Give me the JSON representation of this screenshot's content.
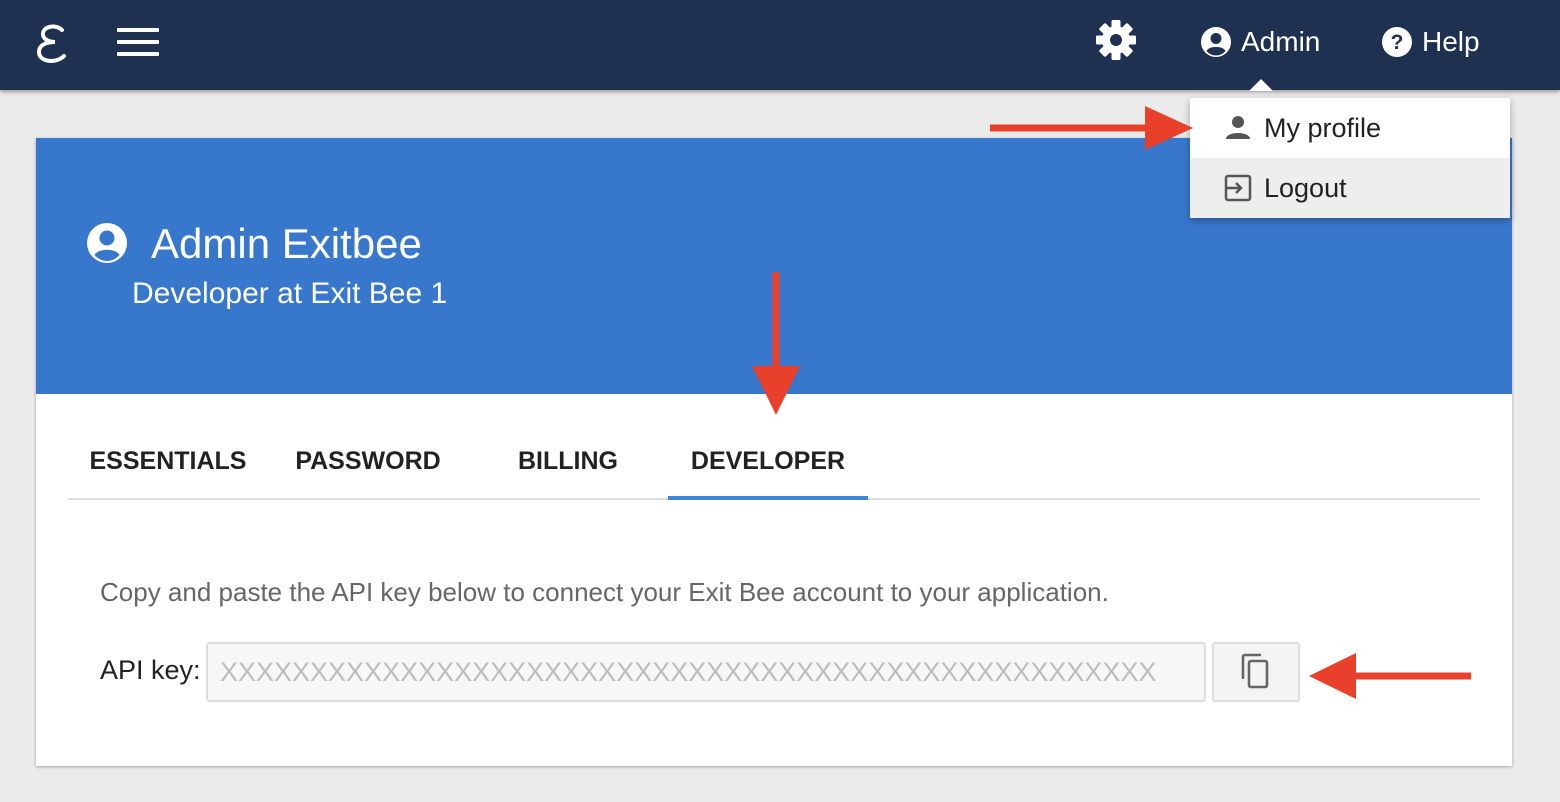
{
  "header": {
    "logo_icon": "exitbee-e-logo",
    "menu_icon": "hamburger-menu-icon",
    "settings_icon": "gear-icon",
    "admin_label": "Admin",
    "help_label": "Help",
    "background_color": "#1e3151"
  },
  "dropdown": {
    "items": [
      {
        "icon": "person-icon",
        "label": "My profile"
      },
      {
        "icon": "logout-icon",
        "label": "Logout"
      }
    ]
  },
  "profile": {
    "name": "Admin Exitbee",
    "role": "Developer at Exit Bee 1",
    "banner_color": "#3778cc"
  },
  "tabs": [
    {
      "label": "ESSENTIALS"
    },
    {
      "label": "PASSWORD"
    },
    {
      "label": "BILLING"
    },
    {
      "label": "DEVELOPER",
      "active": true
    }
  ],
  "developer": {
    "description": "Copy and paste the API key below to connect your Exit Bee account to your application.",
    "api_key_label": "API key:",
    "api_key_value": "XXXXXXXXXXXXXXXXXXXXXXXXXXXXXXXXXXXXXXXXXXXXXXXXXXXX",
    "copy_icon": "copy-icon"
  },
  "colors": {
    "accent": "#3a86d9",
    "annotation_arrow": "#e8402a"
  }
}
